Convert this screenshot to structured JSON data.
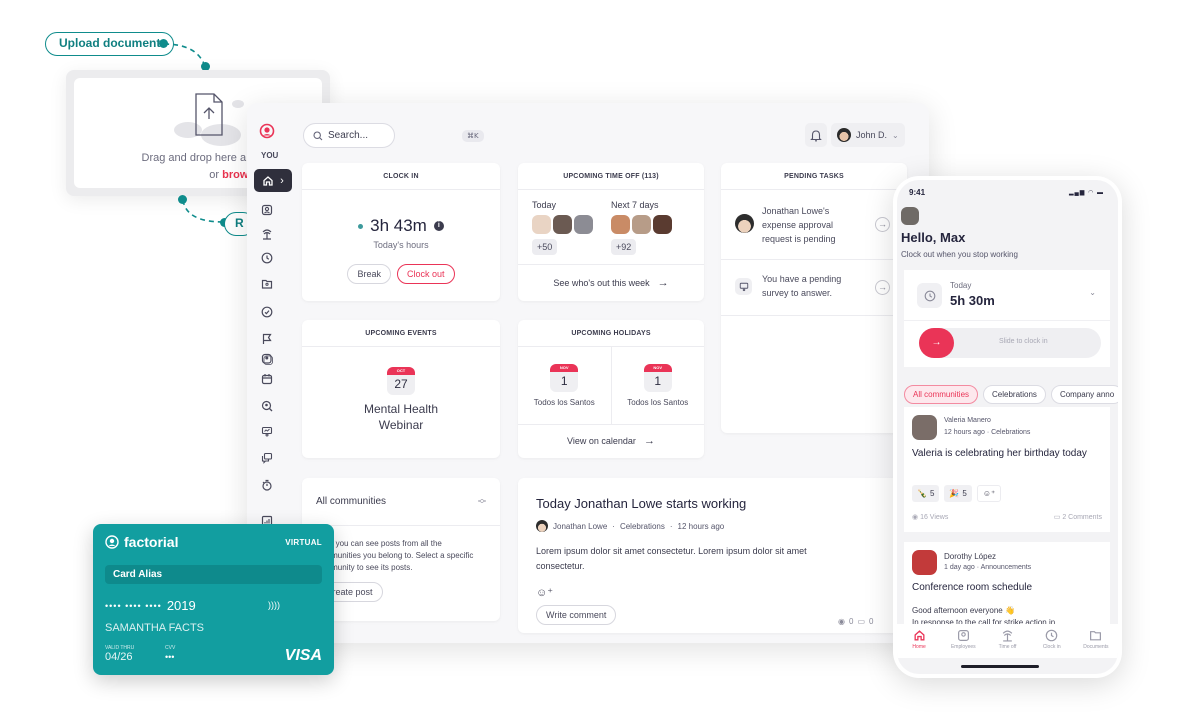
{
  "upload": {
    "pill_label": "Upload document",
    "second_pill_partial": "R",
    "drop_text": "Drag and drop here a PDF do",
    "or_text": "or",
    "browse_link": "browse file/s",
    "accent": "#0f8c8c"
  },
  "app": {
    "sidebar": {
      "you_label": "YOU",
      "items": [
        {
          "name": "home",
          "active": true
        },
        {
          "name": "employees"
        },
        {
          "name": "time-off"
        },
        {
          "name": "clock-in"
        },
        {
          "name": "documents"
        },
        {
          "name": "tasks"
        },
        {
          "name": "goals"
        },
        {
          "name": "people"
        },
        {
          "name": "calendar"
        },
        {
          "name": "recruitment"
        },
        {
          "name": "surveys"
        },
        {
          "name": "communities"
        },
        {
          "name": "timer"
        },
        {
          "name": "reports"
        }
      ]
    },
    "header": {
      "search_placeholder": "Search...",
      "shortcut": "⌘K",
      "user_name": "John D."
    },
    "clock_in": {
      "title": "CLOCK IN",
      "hours": "3h 43m",
      "subtitle": "Today's hours",
      "break_label": "Break",
      "clock_out_label": "Clock out"
    },
    "time_off": {
      "title": "UPCOMING TIME OFF (113)",
      "today_label": "Today",
      "today_more": "+50",
      "next_label": "Next 7 days",
      "next_more": "+92",
      "link": "See who's out this week"
    },
    "pending_tasks": {
      "title": "PENDING TASKS",
      "items": [
        {
          "text": "Jonathan Lowe's expense approval request is pending"
        },
        {
          "text": "You have a pending survey to answer."
        }
      ]
    },
    "events": {
      "title": "UPCOMING EVENTS",
      "month": "OCT",
      "day": "27",
      "name": "Mental Health Webinar"
    },
    "holidays": {
      "title": "UPCOMING HOLIDAYS",
      "items": [
        {
          "month": "NOV",
          "day": "1",
          "name": "Todos los Santos"
        },
        {
          "month": "NOV",
          "day": "1",
          "name": "Todos los Santos"
        }
      ],
      "link": "View on calendar"
    },
    "communities": {
      "select_label": "All communities",
      "description": "Here you can see posts from all the communities you belong to. Select a specific community to see its posts.",
      "create_label": "Create post"
    },
    "post": {
      "title": "Today Jonathan Lowe starts working",
      "author": "Jonathan Lowe",
      "category": "Celebrations",
      "time": "12 hours ago",
      "body": "Lorem ipsum dolor sit amet consectetur. Lorem ipsum dolor sit amet consectetur.",
      "comment_label": "Write comment",
      "views": "0",
      "comments": "0"
    }
  },
  "card": {
    "brand": "factorial",
    "type": "VIRTUAL",
    "alias": "Card Alias",
    "number_masked": "•••• •••• ••••",
    "number_last": "2019",
    "holder": "SAMANTHA FACTS",
    "valid_label": "VALID THRU",
    "valid": "04/26",
    "cvv_label": "CVV",
    "cvv": "•••",
    "network": "VISA",
    "color": "#129ea0"
  },
  "phone": {
    "time": "9:41",
    "greeting": "Hello, Max",
    "subtitle": "Clock out when you stop working",
    "today_label": "Today",
    "today_hours": "5h 30m",
    "slide_label": "Slide to clock in",
    "chips": [
      "All communities",
      "Celebrations",
      "Company anno"
    ],
    "posts": [
      {
        "author": "Valeria Manero",
        "time": "12 hours ago",
        "category": "Celebrations",
        "title": "Valeria is celebrating her birthday today",
        "reactions": [
          {
            "emoji": "🍾",
            "count": "5"
          },
          {
            "emoji": "🎉",
            "count": "5"
          }
        ],
        "views": "16 Views",
        "comments": "2 Comments"
      },
      {
        "author": "Dorothy López",
        "time": "1 day ago",
        "category": "Announcements",
        "title": "Conference room schedule",
        "body": "Good afternoon everyone 👋",
        "body2": "In response to the call for strike action in"
      }
    ],
    "tabs": [
      {
        "label": "Home",
        "active": true
      },
      {
        "label": "Employees"
      },
      {
        "label": "Time off"
      },
      {
        "label": "Clock in"
      },
      {
        "label": "Documents"
      }
    ]
  }
}
